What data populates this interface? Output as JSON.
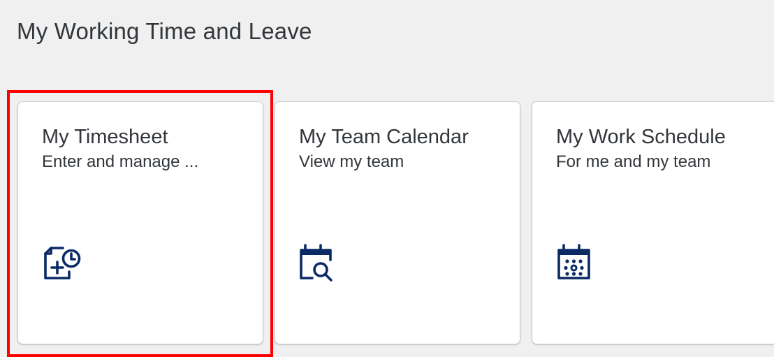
{
  "section": {
    "title": "My Working Time and Leave"
  },
  "tiles": [
    {
      "title": "My Timesheet",
      "subtitle": "Enter and manage ...",
      "icon": "timesheet-add-clock-icon",
      "highlighted": true
    },
    {
      "title": "My Team Calendar",
      "subtitle": "View my team",
      "icon": "calendar-search-icon",
      "highlighted": false
    },
    {
      "title": "My Work Schedule",
      "subtitle": "For me and my team",
      "icon": "calendar-schedule-icon",
      "highlighted": false
    }
  ],
  "colors": {
    "background": "#f0f0f0",
    "tile_background": "#ffffff",
    "text": "#32363a",
    "icon": "#0a2a66",
    "highlight_border": "#ff0000"
  }
}
